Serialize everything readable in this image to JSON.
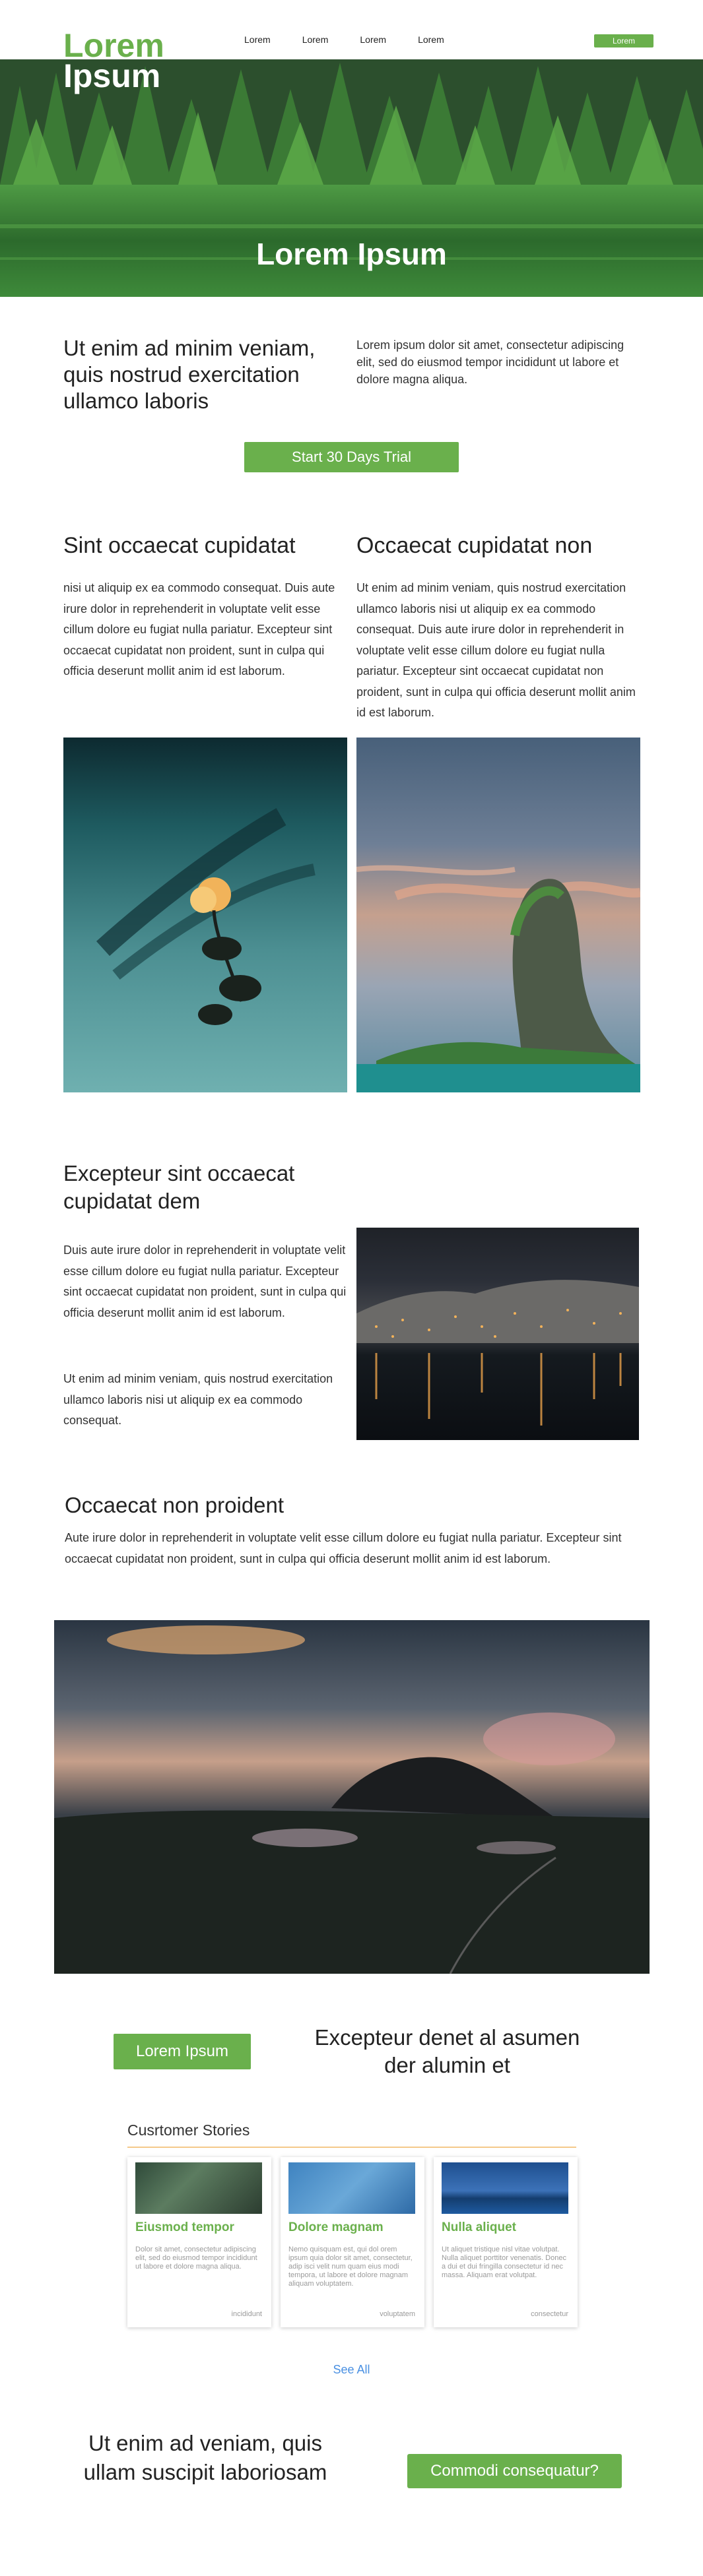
{
  "header": {
    "logo_line1": "Lorem",
    "logo_line2": "Ipsum",
    "nav": [
      "Lorem",
      "Lorem",
      "Lorem",
      "Lorem"
    ],
    "cta_label": "Lorem"
  },
  "hero": {
    "title": "Lorem Ipsum"
  },
  "intro": {
    "heading": "Ut enim ad minim veniam, quis nostrud exercitation ullamco laboris",
    "text": "Lorem ipsum dolor sit amet, consectetur adipiscing elit, sed do eiusmod tempor incididunt ut labore et dolore magna aliqua.",
    "trial_button": "Start 30 Days Trial"
  },
  "columns": [
    {
      "heading": "Sint occaecat cupidatat",
      "text": " nisi ut aliquip ex ea commodo consequat. Duis aute irure dolor in reprehenderit in voluptate velit esse cillum dolore eu fugiat nulla pariatur. Excepteur sint occaecat cupidatat non proident, sunt in culpa qui officia deserunt mollit anim id est laborum."
    },
    {
      "heading": "Occaecat cupidatat non",
      "text": "Ut enim ad minim veniam, quis nostrud exercitation ullamco laboris nisi ut aliquip ex ea commodo consequat. Duis aute irure dolor in reprehenderit in voluptate velit esse cillum dolore eu fugiat nulla pariatur. Excepteur sint occaecat cupidatat non proident, sunt in culpa qui officia deserunt mollit anim id est laborum."
    }
  ],
  "excepteur": {
    "heading": "Excepteur sint occaecat cupidatat  dem",
    "para1": "Duis aute irure dolor in reprehenderit in voluptate velit esse cillum dolore eu fugiat nulla pariatur. Excepteur sint occaecat cupidatat non proident, sunt in culpa qui officia deserunt mollit anim id est laborum.",
    "para2": "Ut enim ad minim veniam, quis nostrud exercitation ullamco laboris nisi ut aliquip ex ea commodo consequat."
  },
  "proident": {
    "heading": "Occaecat non proident",
    "text": "Aute irure dolor in reprehenderit in voluptate velit esse cillum dolore eu fugiat nulla pariatur. Excepteur sint occaecat cupidatat non proident, sunt in culpa qui officia deserunt mollit anim id est laborum."
  },
  "cta": {
    "button": "Lorem Ipsum",
    "heading": "Excepteur denet al asumen der alumin et"
  },
  "stories": {
    "title": "Cusrtomer Stories",
    "cards": [
      {
        "title": "Eiusmod tempor",
        "text": "Dolor sit amet, consectetur adipiscing elit, sed do eiusmod tempor incididunt ut labore et dolore magna aliqua.",
        "foot": "incididunt"
      },
      {
        "title": "Dolore magnam",
        "text": "Nemo quisquam est, qui dol orem ipsum quia dolor sit amet, consectetur, adip isci velit num quam eius modi tempora, ut labore et dolore magnam aliquam voluptatem.",
        "foot": "voluptatem"
      },
      {
        "title": "Nulla aliquet",
        "text": "Ut aliquet tristique nisl vitae volutpat. Nulla aliquet porttitor venenatis. Donec a dui et dui fringilla consectetur id nec massa. Aliquam erat volutpat.",
        "foot": "consectetur"
      }
    ],
    "see_all": "See All"
  },
  "footer_cta": {
    "heading": "Ut enim ad veniam, quis ullam suscipit laboriosam",
    "button": "Commodi consequatur?"
  },
  "colors": {
    "accent": "#6ab04c",
    "link": "#4a90e2",
    "rule": "#f5c98a"
  }
}
